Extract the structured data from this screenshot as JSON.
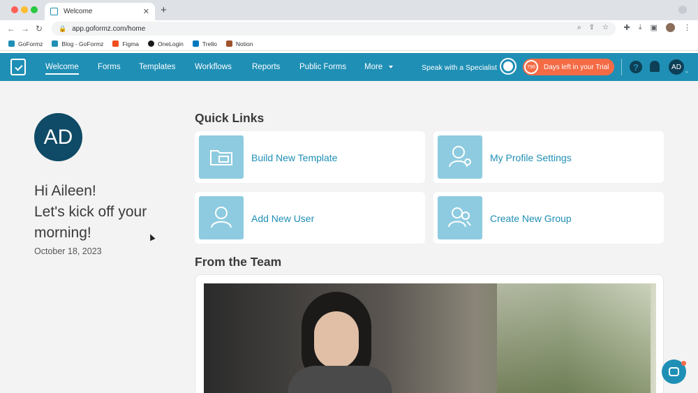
{
  "browser": {
    "tab_title": "Welcome",
    "tab_close": "✕",
    "new_tab": "+",
    "url": "app.goformz.com/home",
    "bookmarks": [
      {
        "label": "GoFormz",
        "color": "#1f8fb5"
      },
      {
        "label": "Blog - GoFormz",
        "color": "#1f8fb5"
      },
      {
        "label": "Figma",
        "color": "#f24e1e"
      },
      {
        "label": "OneLogin",
        "color": "#1a1a1a"
      },
      {
        "label": "Trello",
        "color": "#0079bf"
      },
      {
        "label": "Notion",
        "color": "#a0522d"
      }
    ]
  },
  "nav": {
    "items": [
      "Welcome",
      "Forms",
      "Templates",
      "Workflows",
      "Reports",
      "Public Forms",
      "More"
    ],
    "speak": "Speak with a Specialist",
    "trial_days": "796",
    "trial_text": "Days left in your Trial",
    "help": "?",
    "avatar": "AD"
  },
  "profile": {
    "initials": "AD",
    "greeting_line1": "Hi Aileen!",
    "greeting_line2": "Let's kick off your",
    "greeting_line3": "morning!",
    "date": "October 18, 2023"
  },
  "quick_links": {
    "title": "Quick Links",
    "items": [
      "Build New Template",
      "My Profile Settings",
      "Add New User",
      "Create New Group"
    ]
  },
  "team": {
    "title": "From the Team"
  },
  "colors": {
    "brand": "#1f8fb5",
    "accent": "#f46b45",
    "dark": "#0f4a66"
  }
}
